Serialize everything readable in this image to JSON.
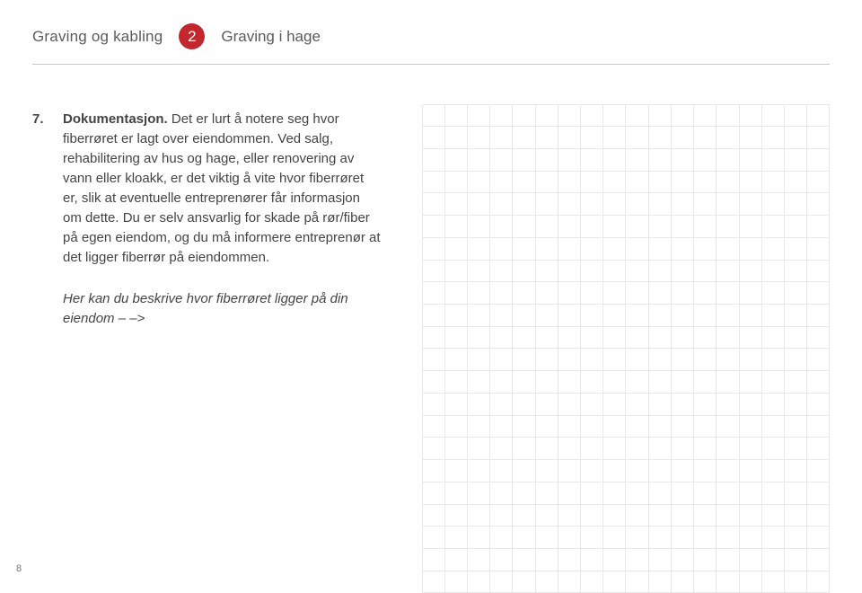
{
  "header": {
    "breadcrumb_left": "Graving og kabling",
    "badge_number": "2",
    "breadcrumb_right": "Graving i hage"
  },
  "item": {
    "number": "7.",
    "title": "Dokumentasjon.",
    "text": " Det er lurt å notere seg hvor fiberrøret er lagt over eiendommen. Ved salg, rehabilitering av hus og hage, eller renovering av vann eller kloakk, er det viktig å vite hvor fiberrøret er, slik at eventuelle entreprenører får informasjon om dette. Du er selv ansvarlig for skade på rør/fiber på egen eiendom, og du må informere entreprenør at det ligger fiberrør på eiendommen."
  },
  "note": "Her kan du beskrive hvor fiberrøret ligger på din eiendom  – –>",
  "grid": {
    "cols": 18,
    "rows": 22
  },
  "page_number": "8"
}
